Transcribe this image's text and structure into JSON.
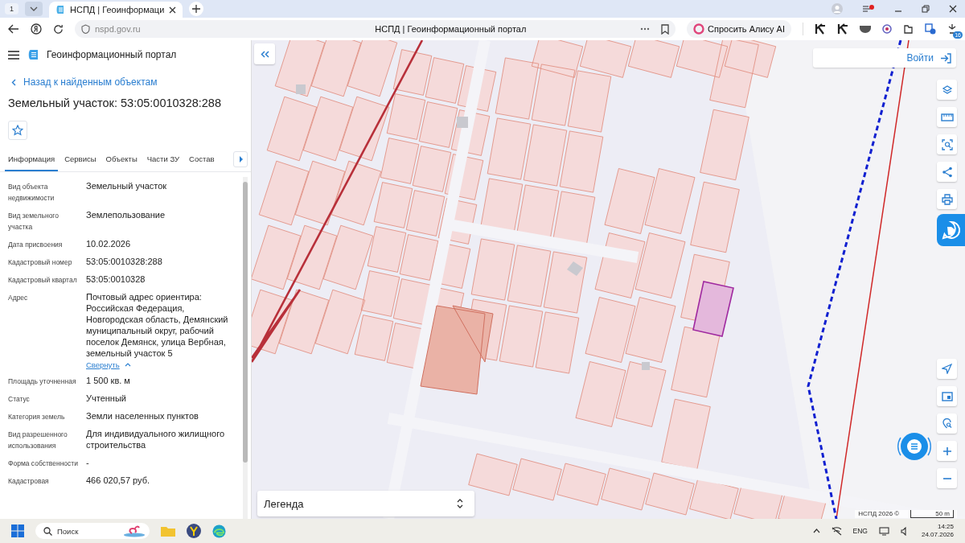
{
  "browser": {
    "tab_count": "1",
    "tabs": [
      {
        "title": "НСПД | Геоинформаци",
        "selected": true
      }
    ],
    "notification_dot": true,
    "url": "nspd.gov.ru",
    "page_title": "НСПД | Геоинформационный портал",
    "alice_button": "Спросить Алису AI",
    "extension_badge": "16"
  },
  "portal": {
    "title": "Геоинформационный портал",
    "back_link": "Назад к найденным объектам",
    "object_title": "Земельный участок: 53:05:0010328:288"
  },
  "tabs": [
    {
      "label": "Информация",
      "selected": true
    },
    {
      "label": "Сервисы",
      "selected": false
    },
    {
      "label": "Объекты",
      "selected": false
    },
    {
      "label": "Части ЗУ",
      "selected": false
    },
    {
      "label": "Состав",
      "selected": false
    }
  ],
  "properties": [
    {
      "label": "Вид объекта недвижимости",
      "value": "Земельный участок"
    },
    {
      "label": "Вид земельного участка",
      "value": "Землепользование"
    },
    {
      "label": "Дата присвоения",
      "value": "10.02.2026"
    },
    {
      "label": "Кадастровый номер",
      "value": "53:05:0010328:288"
    },
    {
      "label": "Кадастровый квартал",
      "value": "53:05:0010328"
    },
    {
      "label": "Адрес",
      "value": "Почтовый адрес ориентира: Российская Федерация, Новгородская область, Демянский муниципальный округ, рабочий поселок Демянск, улица Вербная, земельный участок 5",
      "toggle_link": "Свернуть"
    },
    {
      "label": "Площадь уточненная",
      "value": "1 500 кв. м"
    },
    {
      "label": "Статус",
      "value": "Учтенный"
    },
    {
      "label": "Категория земель",
      "value": "Земли населенных пунктов"
    },
    {
      "label": "Вид разрешенного использования",
      "value": "Для индивидуального жилищного строительства"
    },
    {
      "label": "Форма собственности",
      "value": "-"
    },
    {
      "label": "Кадастровая",
      "value": "466 020,57 руб."
    }
  ],
  "map": {
    "kind": "picture",
    "login_button": "Войти",
    "legend": "Легенда",
    "attribution": "НСПД 2026 ©",
    "scale": "50 m"
  },
  "taskbar": {
    "search_placeholder": "Поиск",
    "language": "ENG",
    "time": "14:25",
    "date": "24.07.2026"
  }
}
